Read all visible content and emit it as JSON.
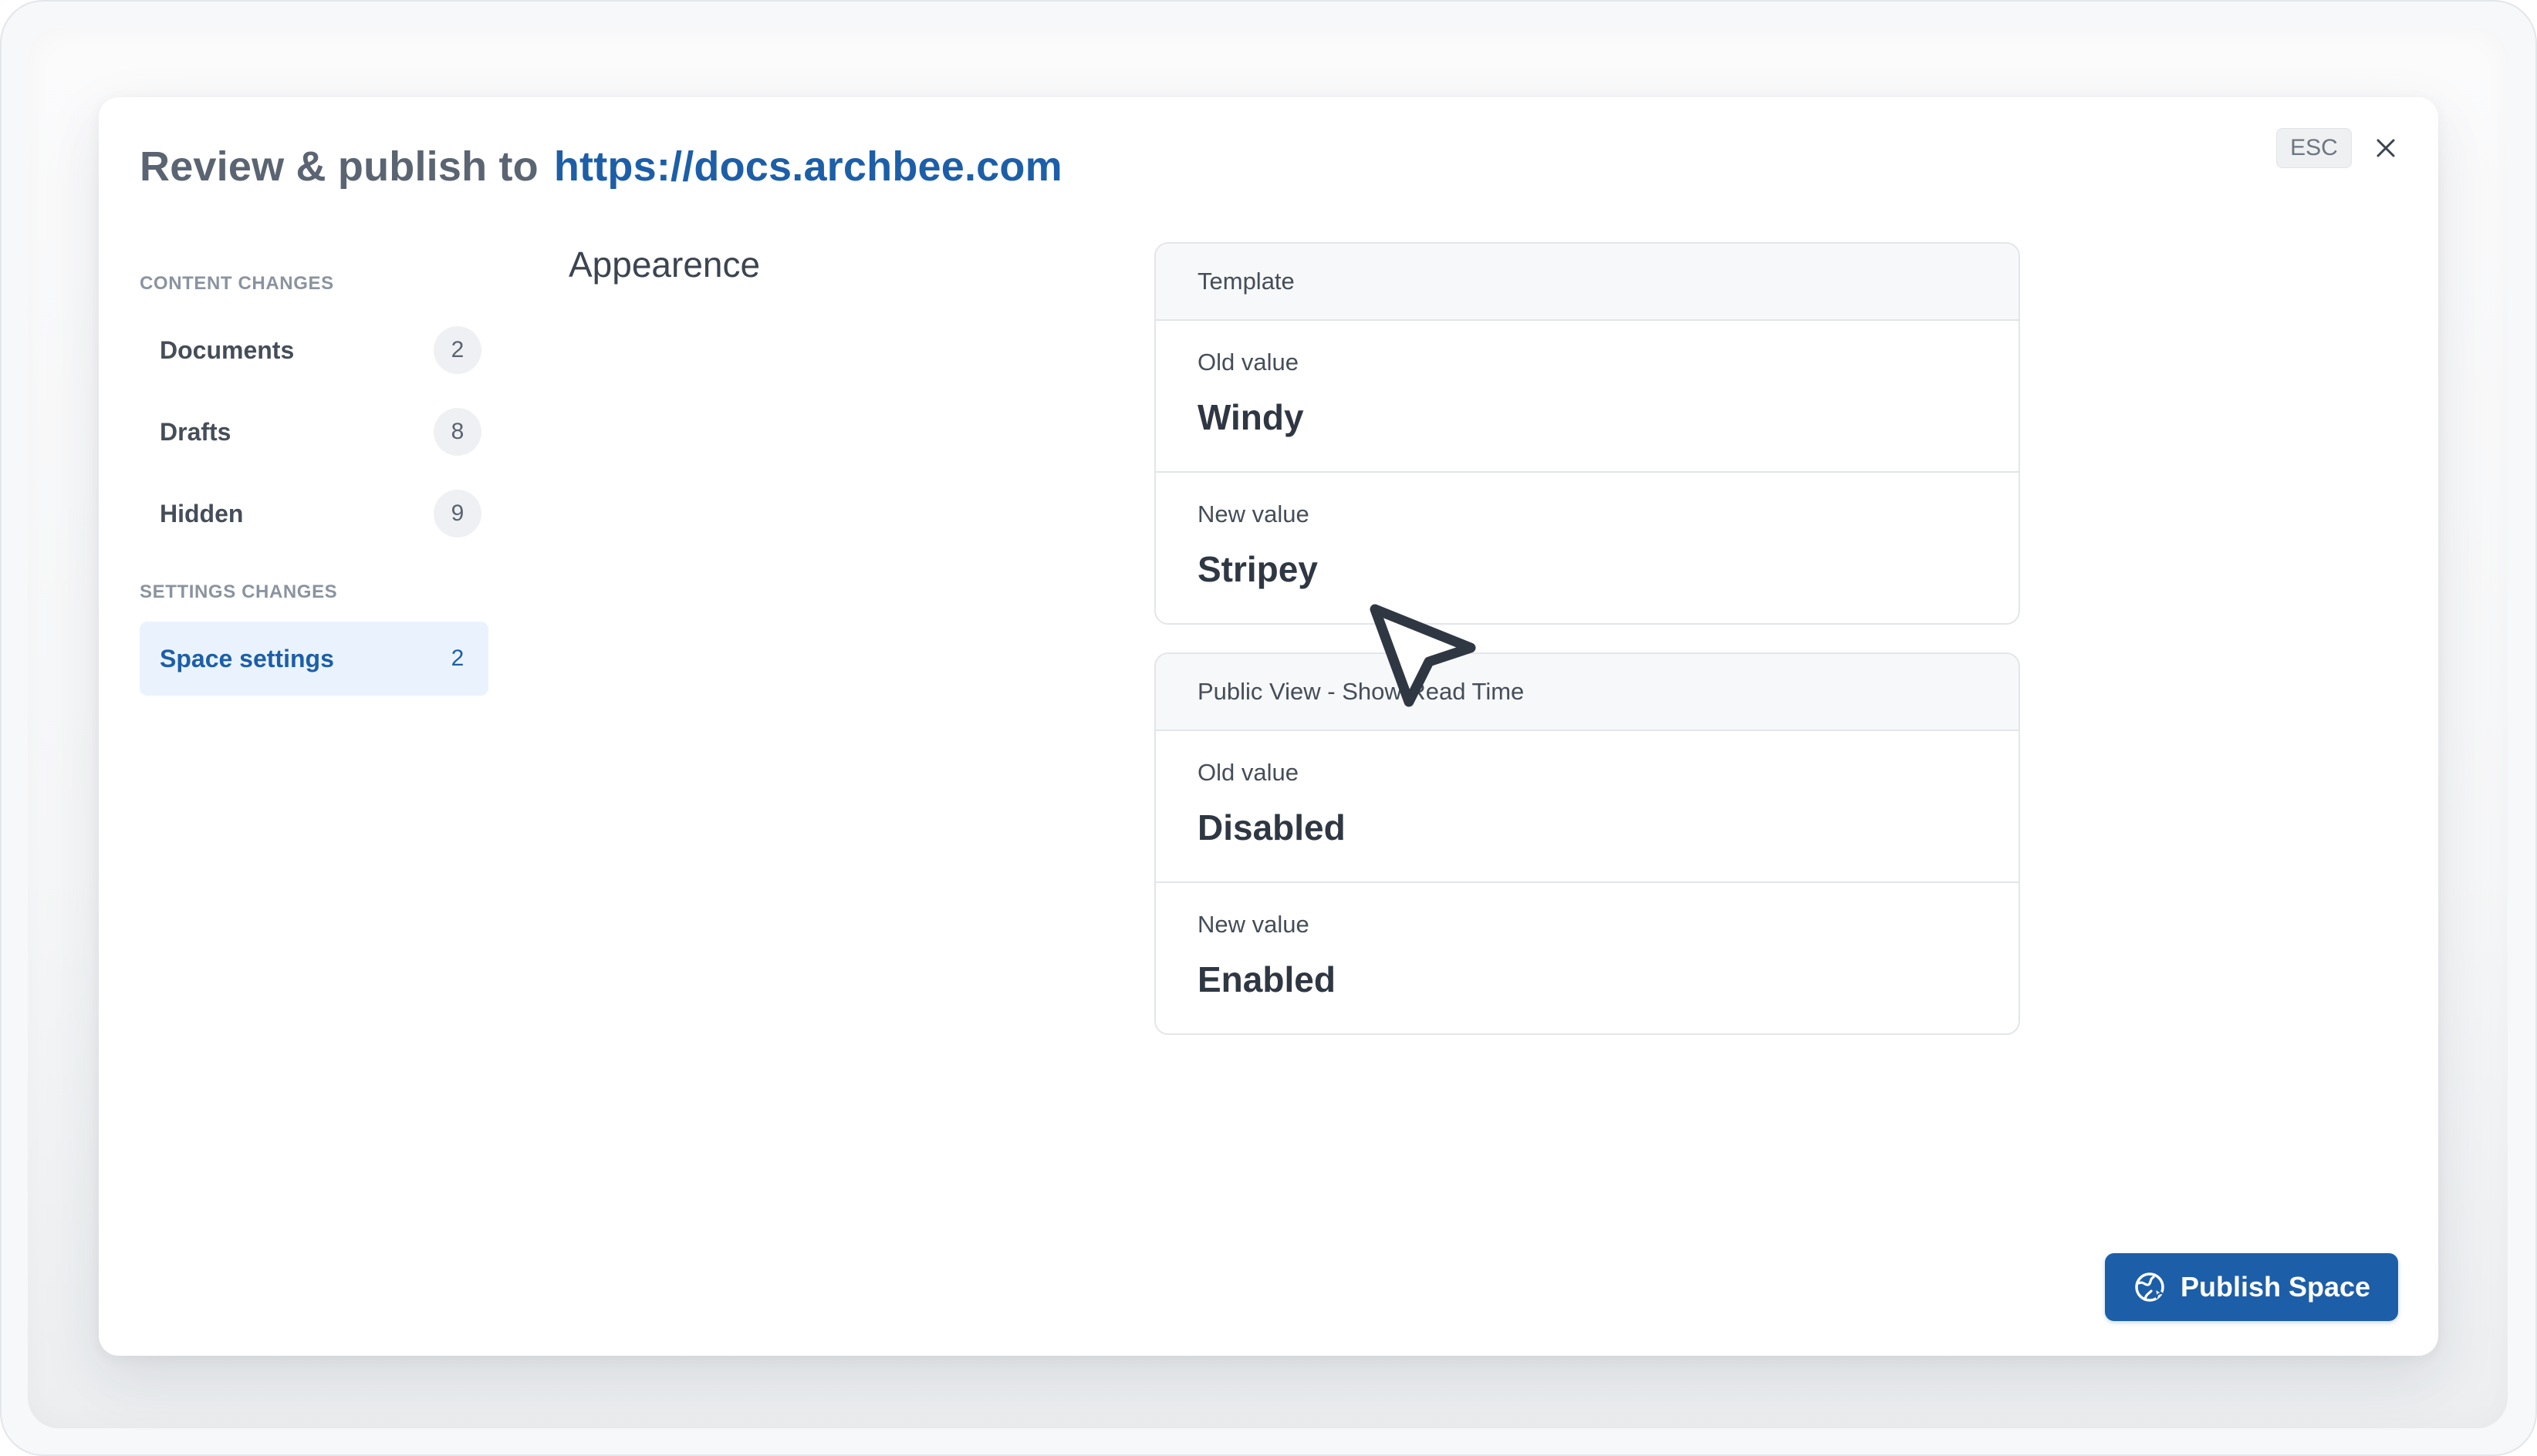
{
  "modal": {
    "title_prefix": "Review & publish to",
    "title_link": "https://docs.archbee.com",
    "esc_label": "ESC"
  },
  "sidebar": {
    "content_section_label": "CONTENT CHANGES",
    "settings_section_label": "SETTINGS CHANGES",
    "items": [
      {
        "label": "Documents",
        "count": "2",
        "active": false
      },
      {
        "label": "Drafts",
        "count": "8",
        "active": false
      },
      {
        "label": "Hidden",
        "count": "9",
        "active": false
      },
      {
        "label": "Space settings",
        "count": "2",
        "active": true
      }
    ]
  },
  "main": {
    "section_title": "Appearence",
    "cards": [
      {
        "header": "Template",
        "old_label": "Old value",
        "old_value": "Windy",
        "new_label": "New value",
        "new_value": "Stripey"
      },
      {
        "header": "Public View - Show Read Time",
        "old_label": "Old value",
        "old_value": "Disabled",
        "new_label": "New value",
        "new_value": "Enabled"
      }
    ]
  },
  "footer": {
    "publish_label": "Publish Space"
  },
  "colors": {
    "accent": "#1d5ea8",
    "active_bg": "#eaf3fd",
    "muted_text": "#8b93a0"
  },
  "icons": {
    "close": "close-icon",
    "publish": "globe-publish-icon",
    "cursor": "pointer-cursor-icon"
  }
}
